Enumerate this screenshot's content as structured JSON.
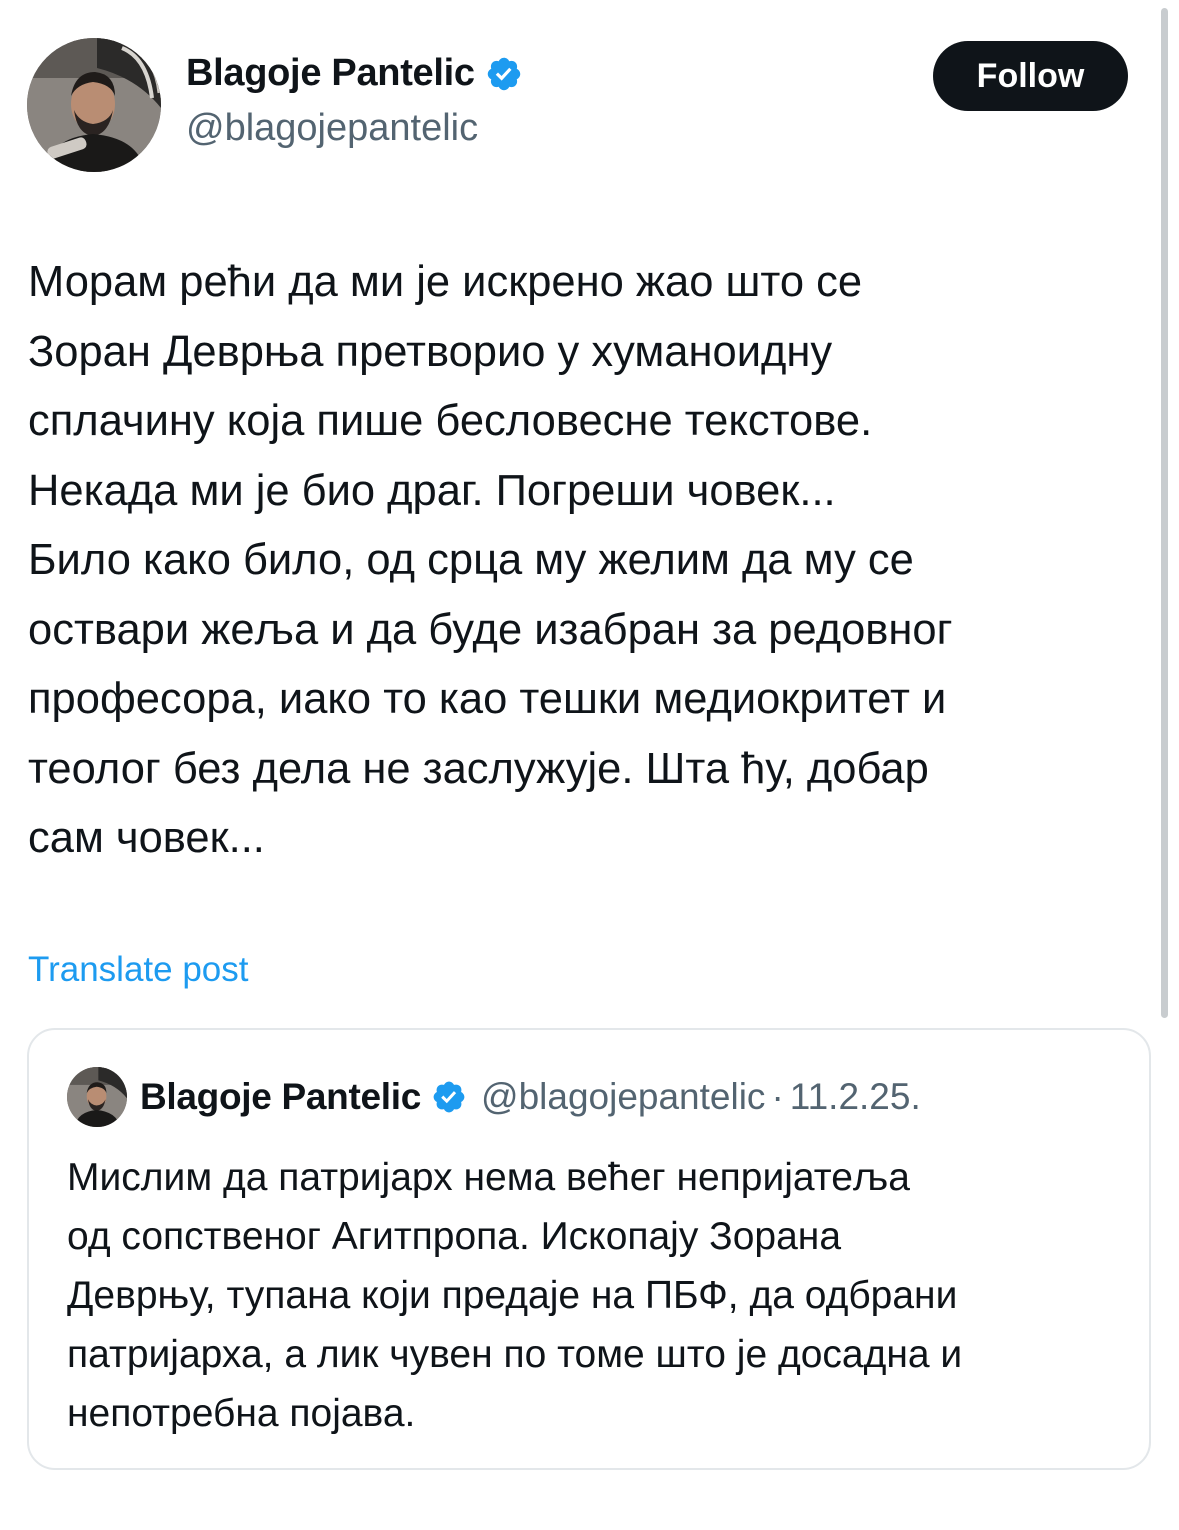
{
  "post": {
    "author": {
      "name": "Blagoje Pantelic",
      "handle": "@blagojepantelic",
      "verified": true
    },
    "follow_label": "Follow",
    "text_lines": [
      "Морам рећи да ми је искрено жао што се",
      "Зоран Деврња претворио у хуманоидну",
      "сплачину која пише бесловесне текстове.",
      "Некада ми је био драг. Погреши човек...",
      "Било како било, од срца му желим да му се",
      "оствари жеља и да буде изабран за редовног",
      "професора, иако то као тешки медиокритет и",
      "теолог без дела не заслужује. Шта ћу, добар",
      "сам човек..."
    ],
    "translate_label": "Translate post"
  },
  "quoted_post": {
    "author": {
      "name": "Blagoje Pantelic",
      "handle": "@blagojepantelic",
      "verified": true
    },
    "separator": "·",
    "date": "11.2.25.",
    "text_lines": [
      "Мислим да патријарх нема већег непријатеља",
      "од сопственог Агитпропа. Ископају Зорана",
      "Деврњу, тупана који предаје на ПБФ, да одбрани",
      "патријарха, а лик чувен по томе што је досадна и",
      "непотребна појава."
    ]
  },
  "icons": {
    "avatar": "profile-photo",
    "verified": "verified-badge-icon"
  },
  "colors": {
    "text": "#0f1419",
    "secondary_text": "#536471",
    "link": "#1d9bf0",
    "verified": "#1d9bf0",
    "follow_button_bg": "#0f1419",
    "follow_button_text": "#ffffff",
    "card_border": "#e3e7ea"
  }
}
